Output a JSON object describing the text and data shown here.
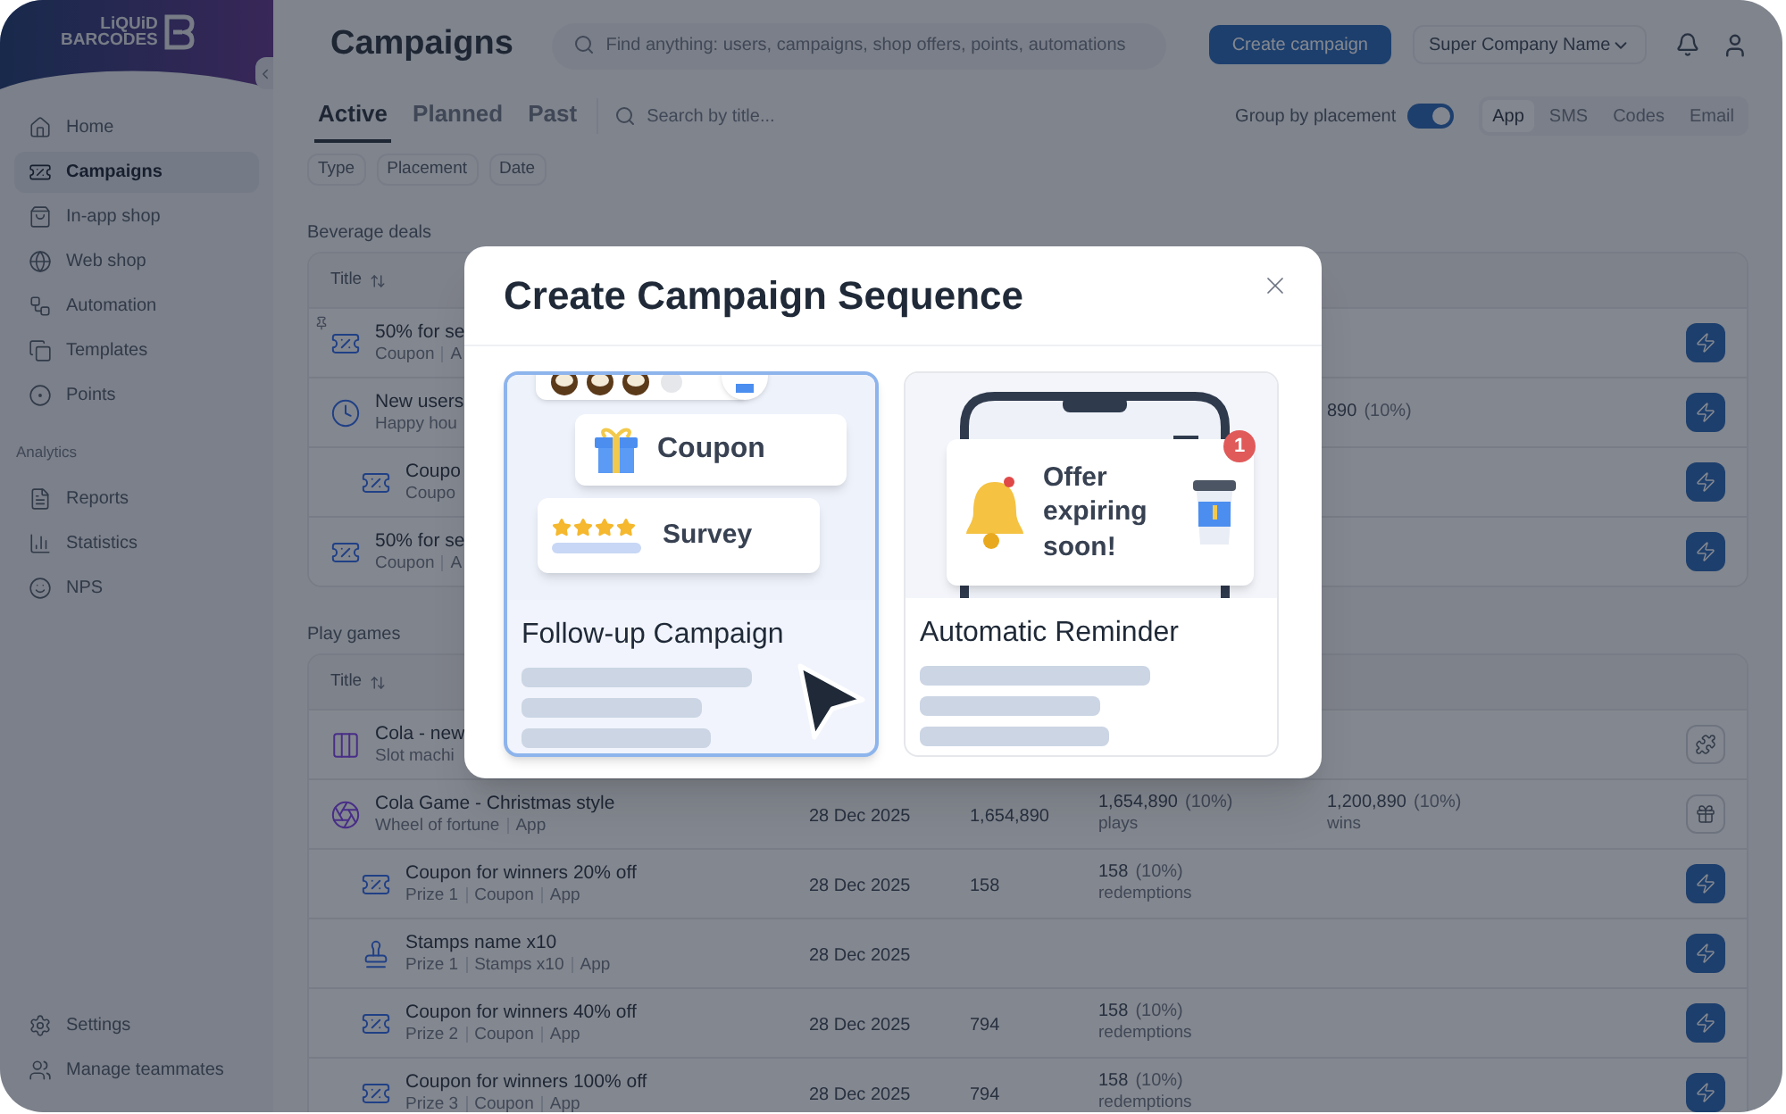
{
  "logo": {
    "line1": "LiQUiD",
    "line2": "BARCODES"
  },
  "sidebar": {
    "items": [
      {
        "label": "Home",
        "selected": false
      },
      {
        "label": "Campaigns",
        "selected": true
      },
      {
        "label": "In-app shop",
        "selected": false
      },
      {
        "label": "Web shop",
        "selected": false
      },
      {
        "label": "Automation",
        "selected": false
      },
      {
        "label": "Templates",
        "selected": false
      },
      {
        "label": "Points",
        "selected": false
      }
    ],
    "analytics_heading": "Analytics",
    "analytics": [
      {
        "label": "Reports",
        "selected": false
      },
      {
        "label": "Statistics",
        "selected": false
      },
      {
        "label": "NPS",
        "selected": false
      }
    ],
    "bottom": [
      {
        "label": "Settings",
        "selected": false
      },
      {
        "label": "Manage teammates",
        "selected": false
      }
    ]
  },
  "header": {
    "title": "Campaigns",
    "search": {
      "placeholder": "Find anything: users, campaigns, shop offers, points, automations"
    },
    "create_button": "Create campaign",
    "company": "Super Company Name"
  },
  "tabs": [
    {
      "label": "Active",
      "selected": true
    },
    {
      "label": "Planned",
      "selected": false
    },
    {
      "label": "Past",
      "selected": false
    }
  ],
  "title_search": {
    "placeholder": "Search by title..."
  },
  "group_toggle": {
    "label": "Group by placement",
    "on": true
  },
  "channels": [
    {
      "label": "App",
      "selected": true
    },
    {
      "label": "SMS",
      "selected": false
    },
    {
      "label": "Codes",
      "selected": false
    },
    {
      "label": "Email",
      "selected": false
    }
  ],
  "filters": [
    "Type",
    "Placement",
    "Date"
  ],
  "sections": [
    {
      "heading": "Beverage deals",
      "column": "Title",
      "rows": [
        {
          "kind": "coupon",
          "pinned": true,
          "title": "50% for se",
          "meta": [
            "Coupon",
            "A"
          ],
          "action": {
            "kind": "boost"
          }
        },
        {
          "kind": "timer",
          "pinned": false,
          "title": "New users",
          "meta": [
            "Happy hou"
          ],
          "stat2": {
            "value": "890",
            "pct": "(10%)"
          },
          "action": {
            "kind": "boost"
          },
          "children": [
            {
              "kind": "coupon",
              "pinned": false,
              "title": "Coupo",
              "meta": [
                "Coupo"
              ],
              "action": {
                "kind": "boost"
              }
            }
          ]
        },
        {
          "kind": "coupon",
          "pinned": false,
          "title": "50% for se",
          "meta": [
            "Coupon",
            "A"
          ],
          "action": {
            "kind": "boost"
          }
        }
      ]
    },
    {
      "heading": "Play games",
      "column": "Title",
      "rows": [
        {
          "kind": "slot",
          "pinned": false,
          "title": "Cola - new",
          "meta": [
            "Slot machi"
          ],
          "action": {
            "kind": "puzzle"
          }
        },
        {
          "kind": "wheel",
          "pinned": false,
          "title": "Cola Game - Christmas style",
          "meta": [
            "Wheel of fortune",
            "App"
          ],
          "date": "28 Dec 2025",
          "count": "1,654,890",
          "stat1": {
            "value": "1,654,890",
            "pct": "(10%)",
            "label": "plays"
          },
          "stat2": {
            "value": "1,200,890",
            "pct": "(10%)",
            "label": "wins"
          },
          "action": {
            "kind": "gift"
          },
          "children": [
            {
              "kind": "coupon",
              "pinned": false,
              "title": "Coupon for winners 20% off",
              "meta": [
                "Prize 1",
                "Coupon",
                "App"
              ],
              "date": "28 Dec 2025",
              "count": "158",
              "stat1": {
                "value": "158",
                "pct": "(10%)",
                "label": "redemptions"
              },
              "action": {
                "kind": "boost"
              }
            },
            {
              "kind": "stamp",
              "pinned": false,
              "title": "Stamps name x10",
              "meta": [
                "Prize 1",
                "Stamps x10",
                "App"
              ],
              "date": "28 Dec 2025",
              "action": {
                "kind": "boost"
              }
            },
            {
              "kind": "coupon",
              "pinned": false,
              "title": "Coupon for winners 40% off",
              "meta": [
                "Prize 2",
                "Coupon",
                "App"
              ],
              "date": "28 Dec 2025",
              "count": "794",
              "stat1": {
                "value": "158",
                "pct": "(10%)",
                "label": "redemptions"
              },
              "action": {
                "kind": "boost"
              }
            },
            {
              "kind": "coupon",
              "pinned": false,
              "title": "Coupon for winners 100% off",
              "meta": [
                "Prize 3",
                "Coupon",
                "App"
              ],
              "date": "28 Dec 2025",
              "count": "794",
              "stat1": {
                "value": "158",
                "pct": "(10%)",
                "label": "redemptions"
              },
              "action": {
                "kind": "boost"
              }
            }
          ]
        }
      ]
    }
  ],
  "modal": {
    "title": "Create Campaign Sequence",
    "cards": [
      {
        "kind": "followup",
        "title": "Follow-up Campaign",
        "selected": true,
        "tags": [
          "Coupon",
          "Survey"
        ]
      },
      {
        "kind": "reminder",
        "title": "Automatic Reminder",
        "selected": false,
        "message": "Offer expiring soon!",
        "badge": "1"
      }
    ]
  }
}
